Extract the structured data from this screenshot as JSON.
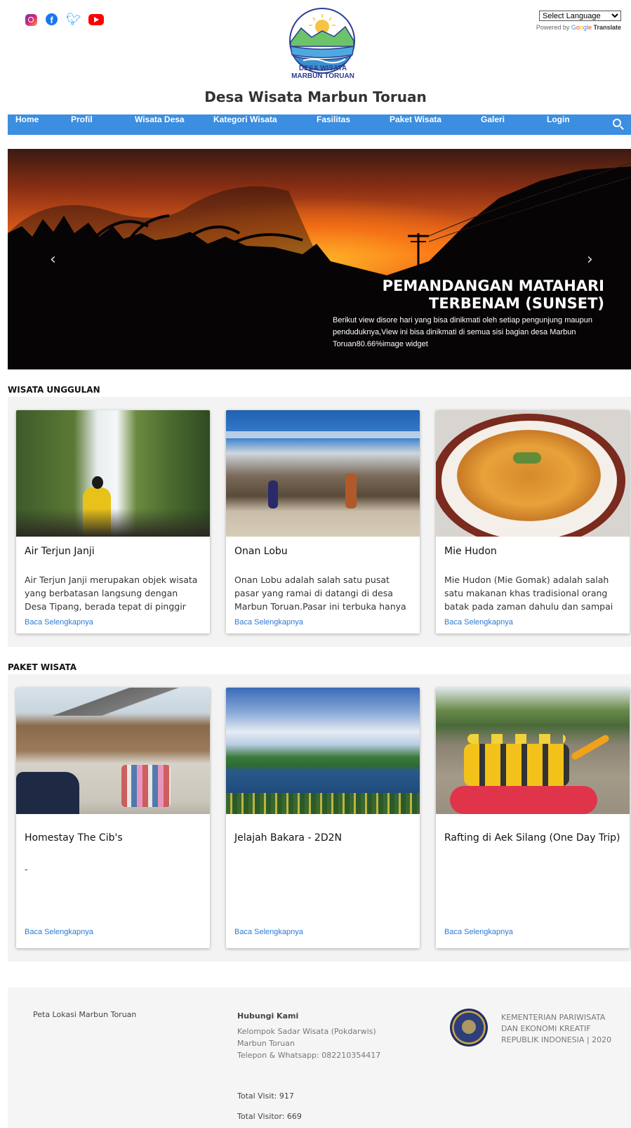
{
  "header": {
    "site_title": "Desa Wisata Marbun Toruan",
    "logo_text_line1": "DESA WISATA",
    "logo_text_line2": "MARBUN TORUAN",
    "language_select": "Select Language",
    "powered_by": "Powered by",
    "translate": "Translate",
    "social_icons": [
      "instagram-icon",
      "facebook-icon",
      "twitter-icon",
      "youtube-icon"
    ]
  },
  "nav": {
    "items": [
      "Home",
      "Profil",
      "Wisata Desa",
      "Kategori Wisata",
      "Fasilitas",
      "Paket Wisata",
      "Galeri",
      "Login"
    ]
  },
  "hero": {
    "title_line1": "PEMANDANGAN MATAHARI",
    "title_line2": "TERBENAM (SUNSET)",
    "description": "Berikut view disore hari yang bisa dinikmati oleh setiap pengunjung maupun penduduknya,View ini bisa dinikmati  di semua sisi bagian desa Marbun Toruan80.66%image widget",
    "prev_arrow": "‹",
    "next_arrow": "›"
  },
  "wisata_unggulan": {
    "title": "WISATA UNGGULAN",
    "cards": [
      {
        "title": "Air Terjun Janji",
        "text": "Air Terjun Janji merupakan objek wisata yang berbatasan langsung dengan Desa Tipang, berada tepat di pinggir jalan lintas",
        "link": "Baca Selengkapnya"
      },
      {
        "title": "Onan Lobu",
        "text": "Onan Lobu adalah salah satu pusat pasar yang ramai di datangi di desa Marbun Toruan.Pasar ini terbuka hanya pada hari",
        "link": "Baca Selengkapnya"
      },
      {
        "title": "Mie Hudon",
        "text": "Mie Hudon (Mie Gomak) adalah salah satu makanan khas tradisional orang batak pada zaman dahulu dan sampai sekarang",
        "link": "Baca Selengkapnya"
      }
    ]
  },
  "paket_wisata": {
    "title": "PAKET WISATA",
    "cards": [
      {
        "title": "Homestay The Cib's",
        "text": "-",
        "link": "Baca Selengkapnya"
      },
      {
        "title": "Jelajah Bakara - 2D2N",
        "text": "",
        "link": "Baca Selengkapnya"
      },
      {
        "title": "Rafting di Aek Silang (One Day Trip)",
        "text": "",
        "link": "Baca Selengkapnya"
      }
    ]
  },
  "footer": {
    "map_title": "Peta Lokasi Marbun Toruan",
    "contact_title": "Hubungi Kami",
    "contact_line1": "Kelompok Sadar Wisata (Pokdarwis)",
    "contact_line2": "Marbun Toruan",
    "contact_line3": "Telepon & Whatsapp: 082210354417",
    "total_visit": "Total Visit: 917",
    "total_visitor": "Total Visitor: 669",
    "kemen_line1": "KEMENTERIAN PARIWISATA",
    "kemen_line2": "DAN EKONOMI KREATIF",
    "kemen_line3": "REPUBLIK INDONESIA | 2020"
  }
}
